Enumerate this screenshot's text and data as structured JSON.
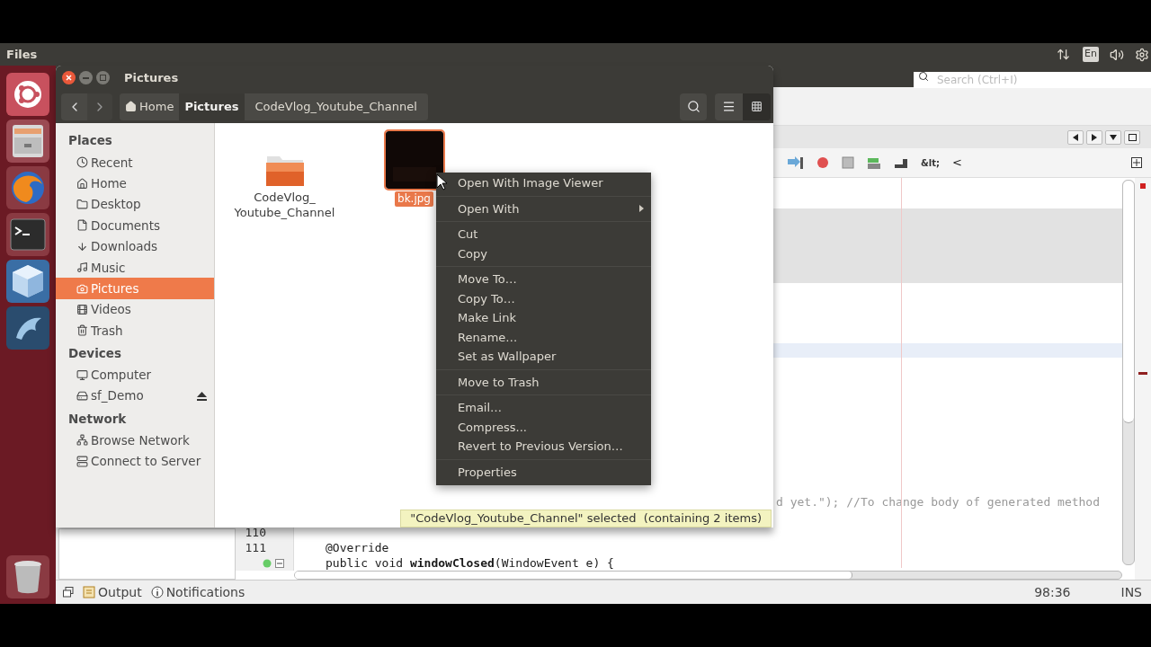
{
  "top_panel": {
    "title": "Files",
    "keyboard": "En"
  },
  "ide": {
    "search": {
      "placeholder": "Search (Ctrl+I)"
    },
    "toolbar_texts": [
      "&lt;",
      "<"
    ],
    "code_lines": [
      {
        "text": "d yet.\"); //To change body of generated method",
        "kind": "comment"
      },
      {
        "number": "110",
        "kind": "code"
      },
      {
        "number": "111",
        "text": "@Override",
        "kind": "code"
      },
      {
        "text": "public void **windowClosed**(WindowEvent e) {",
        "kind": "code",
        "override_mark": true
      }
    ],
    "output_tabs": [
      "Output",
      "Notifications"
    ],
    "position": "98:36",
    "mode": "INS"
  },
  "files_window": {
    "title": "Pictures",
    "path": [
      {
        "label": "Home",
        "selected": false
      },
      {
        "label": "Pictures",
        "selected": true
      },
      {
        "label": "CodeVlog_Youtube_Channel",
        "selected": false
      }
    ],
    "view_buttons": [
      {
        "selected": false
      },
      {
        "selected": true
      }
    ],
    "sidebar": [
      {
        "heading": "Places",
        "items": [
          {
            "label": "Recent",
            "selected": false
          },
          {
            "label": "Home",
            "selected": false
          },
          {
            "label": "Desktop",
            "selected": false
          },
          {
            "label": "Documents",
            "selected": false
          },
          {
            "label": "Downloads",
            "selected": false
          },
          {
            "label": "Music",
            "selected": false
          },
          {
            "label": "Pictures",
            "selected": true
          },
          {
            "label": "Videos",
            "selected": false
          },
          {
            "label": "Trash",
            "selected": false
          }
        ]
      },
      {
        "heading": "Devices",
        "items": [
          {
            "label": "Computer",
            "selected": false
          },
          {
            "label": "sf_Demo",
            "selected": false,
            "eject": true
          }
        ]
      },
      {
        "heading": "Network",
        "items": [
          {
            "label": "Browse Network",
            "selected": false
          },
          {
            "label": "Connect to Server",
            "selected": false
          }
        ]
      }
    ],
    "files": [
      {
        "kind": "folder",
        "name_lines": [
          "CodeVlog_",
          "Youtube_Channel"
        ],
        "selected": false
      },
      {
        "name_lines": [
          "bk.jpg"
        ],
        "selected": true
      }
    ],
    "status": "\"CodeVlog_Youtube_Channel\" selected  (containing 2 items)"
  },
  "context_menu": [
    [
      {
        "label": "Open With Image Viewer",
        "submenu": false
      }
    ],
    [
      {
        "label": "Open With",
        "submenu": true
      }
    ],
    [
      {
        "label": "Cut",
        "submenu": false
      },
      {
        "label": "Copy",
        "submenu": false
      }
    ],
    [
      {
        "label": "Move To…",
        "submenu": false
      },
      {
        "label": "Copy To…",
        "submenu": false
      },
      {
        "label": "Make Link",
        "submenu": false
      },
      {
        "label": "Rename…",
        "submenu": false
      },
      {
        "label": "Set as Wallpaper",
        "submenu": false
      }
    ],
    [
      {
        "label": "Move to Trash",
        "submenu": false
      }
    ],
    [
      {
        "label": "Email…",
        "submenu": false
      },
      {
        "label": "Compress...",
        "submenu": false
      },
      {
        "label": "Revert to Previous Version…",
        "submenu": false
      }
    ],
    [
      {
        "label": "Properties",
        "submenu": false
      }
    ]
  ]
}
